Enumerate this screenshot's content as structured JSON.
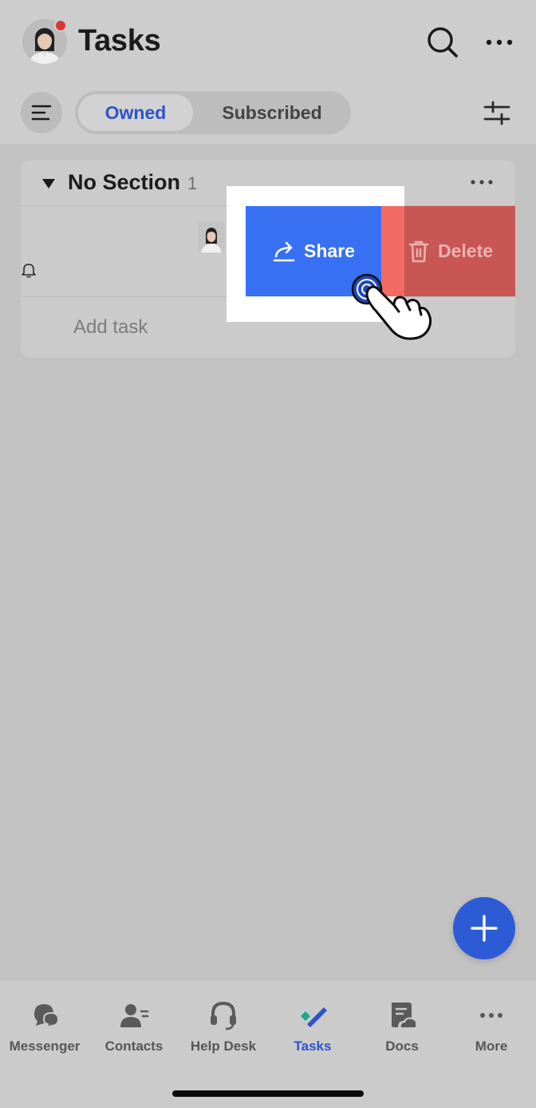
{
  "header": {
    "title": "Tasks",
    "tabs": {
      "owned": "Owned",
      "subscribed": "Subscribed"
    },
    "active_tab": "owned"
  },
  "section": {
    "title": "No Section",
    "count": "1"
  },
  "task_row": {
    "swipe_actions": {
      "share": "Share",
      "delete": "Delete"
    }
  },
  "add_task_label": "Add task",
  "tabbar": {
    "items": [
      {
        "label": "Messenger",
        "icon": "messenger-icon"
      },
      {
        "label": "Contacts",
        "icon": "contacts-icon"
      },
      {
        "label": "Help Desk",
        "icon": "headset-icon"
      },
      {
        "label": "Tasks",
        "icon": "tasks-icon"
      },
      {
        "label": "Docs",
        "icon": "docs-icon"
      },
      {
        "label": "More",
        "icon": "more-dots-icon"
      }
    ],
    "active": "Tasks"
  },
  "colors": {
    "accent": "#2d54c8",
    "share": "#3870f4",
    "delete": "#c85654",
    "notification_dot": "#d63a36"
  }
}
